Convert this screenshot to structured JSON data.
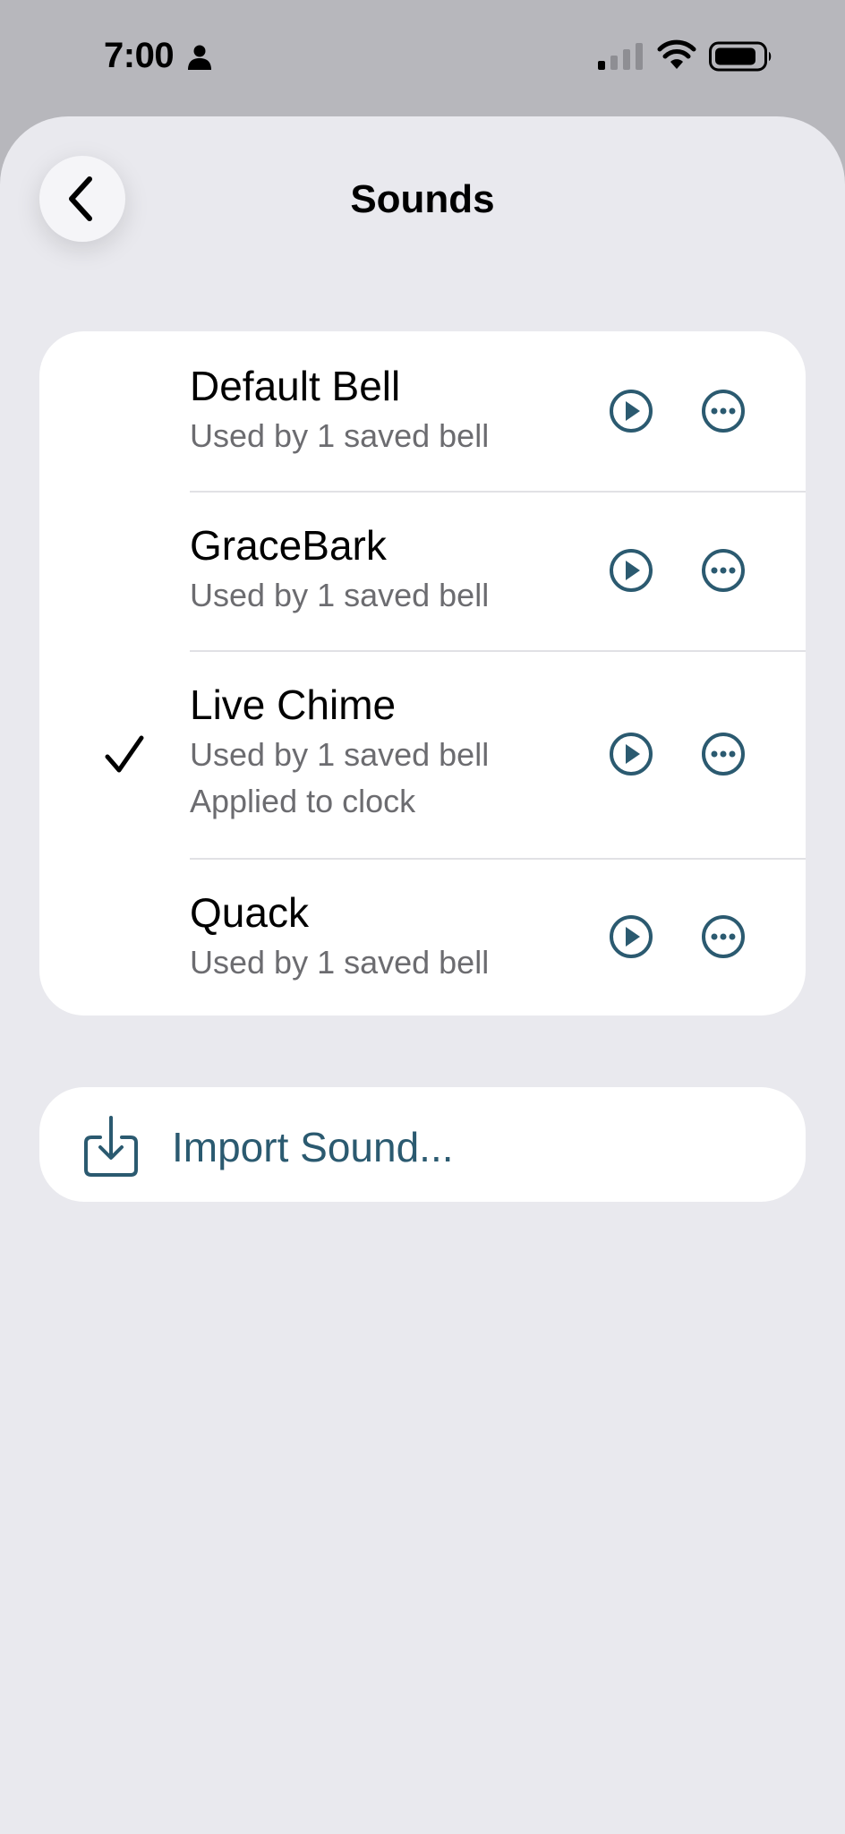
{
  "status_bar": {
    "time": "7:00"
  },
  "header": {
    "title": "Sounds"
  },
  "sounds": [
    {
      "name": "Default Bell",
      "usage": "Used by 1 saved bell",
      "selected": false
    },
    {
      "name": "GraceBark",
      "usage": "Used by 1 saved bell",
      "selected": false
    },
    {
      "name": "Live Chime",
      "usage": "Used by 1 saved bell",
      "extra": "Applied to clock",
      "selected": true
    },
    {
      "name": "Quack",
      "usage": "Used by 1 saved bell",
      "selected": false
    }
  ],
  "import": {
    "label": "Import Sound..."
  },
  "colors": {
    "accent": "#2b5a70",
    "background": "#e9e9ee",
    "card": "#ffffff"
  }
}
